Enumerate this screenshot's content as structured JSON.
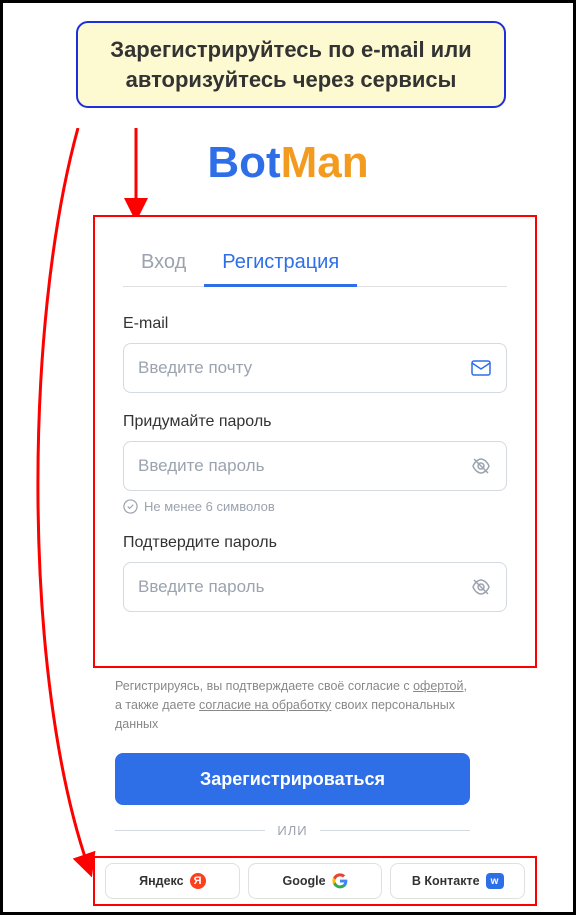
{
  "callout": "Зарегистрируйтесь по e-mail или авторизуйтесь через сервисы",
  "logo": {
    "part1": "Bot",
    "part2": "Man"
  },
  "tabs": {
    "login": "Вход",
    "register": "Регистрация"
  },
  "fields": {
    "email": {
      "label": "E-mail",
      "placeholder": "Введите почту"
    },
    "password": {
      "label": "Придумайте пароль",
      "placeholder": "Введите пароль",
      "hint": "Не менее 6 символов"
    },
    "confirm": {
      "label": "Подтвердите пароль",
      "placeholder": "Введите пароль"
    }
  },
  "consent": {
    "part1": "Регистрируясь, вы подтверждаете своё согласие с ",
    "link1": "офертой",
    "part2": ", а также даете ",
    "link2": "согласие на обработку",
    "part3": " своих персональных данных"
  },
  "register_button": "Зарегистрироваться",
  "divider": "ИЛИ",
  "social": {
    "yandex": "Яндекс",
    "google": "Google",
    "vk": "В Контакте"
  }
}
